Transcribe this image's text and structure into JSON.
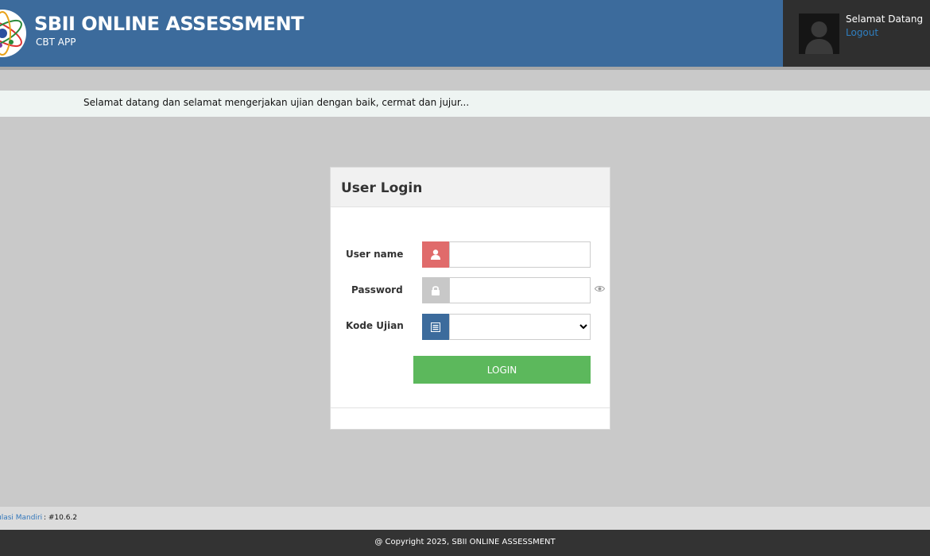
{
  "header": {
    "brand_title": "SBII ONLINE ASSESSMENT",
    "brand_subtitle": "CBT  APP",
    "logo_icon": "atom-logo-icon",
    "bg_color": "#3c6b9c"
  },
  "user": {
    "welcome": "Selamat Datang",
    "logout": "Logout",
    "avatar_icon": "user-silhouette-icon"
  },
  "announcement": "Selamat datang dan selamat mengerjakan ujian dengan baik, cermat dan jujur...",
  "login": {
    "title": "User Login",
    "username_label": "User name",
    "username_value": "",
    "username_icon": "user-icon",
    "password_label": "Password",
    "password_value": "",
    "password_icon": "lock-icon",
    "show_password_icon": "eye-icon",
    "exam_code_label": "Kode Ujian",
    "exam_code_value": "",
    "exam_code_icon": "list-icon",
    "button": "LOGIN",
    "button_color": "#5cb85c"
  },
  "statusbar": {
    "left_text": "ulasi Mandiri",
    "version": ": #10.6.2"
  },
  "footer": {
    "copyright": "@ Copyright 2025, SBII ONLINE ASSESSMENT"
  }
}
